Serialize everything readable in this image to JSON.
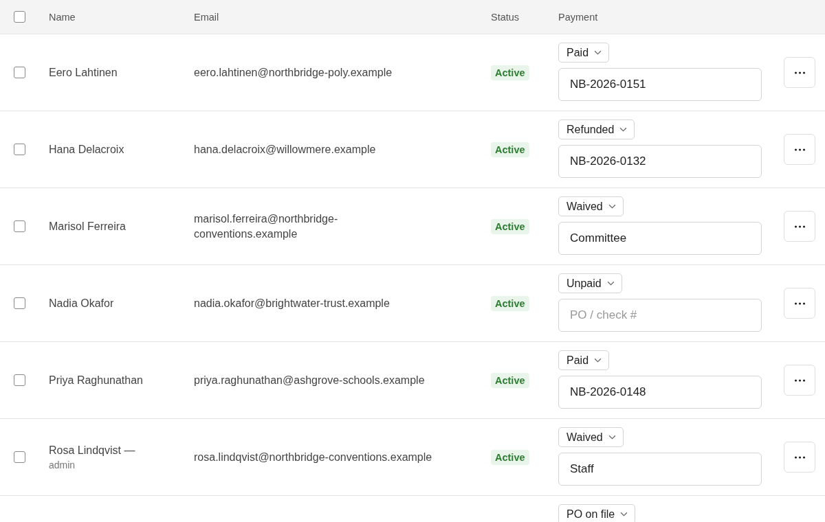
{
  "table": {
    "select_all": {
      "checked": false
    },
    "columns": [
      "Name",
      "Email",
      "Status",
      "Payment"
    ],
    "rows": [
      {
        "checked": false,
        "name": "Eero Lahtinen",
        "email": "eero.lahtinen@northbridge-poly.example",
        "status": "Active",
        "payment": "Paid",
        "reference": "NB-2026-0151"
      },
      {
        "checked": false,
        "name": "Hana Delacroix",
        "email": "hana.delacroix@willowmere.example",
        "status": "Active",
        "payment": "Refunded",
        "reference": "NB-2026-0132"
      },
      {
        "checked": false,
        "name": "Marisol Ferreira",
        "email": "marisol.ferreira@northbridge-conventions.example",
        "status": "Active",
        "payment": "Waived",
        "reference": "Committee"
      },
      {
        "checked": false,
        "name": "Nadia Okafor",
        "email": "nadia.okafor@brightwater-trust.example",
        "status": "Active",
        "payment": "Unpaid",
        "placeholder": "PO / check #"
      },
      {
        "checked": false,
        "name": "Priya Raghunathan",
        "email": "priya.raghunathan@ashgrove-schools.example",
        "status": "Active",
        "payment": "Paid",
        "reference": "NB-2026-0148"
      },
      {
        "checked": false,
        "name": "Rosa Lindqvist —",
        "role": "admin",
        "email": "rosa.lindqvist@northbridge-conventions.example",
        "status": "Active",
        "payment": "Waived",
        "reference": "Staff"
      },
      {
        "payment": "PO on file"
      }
    ]
  }
}
